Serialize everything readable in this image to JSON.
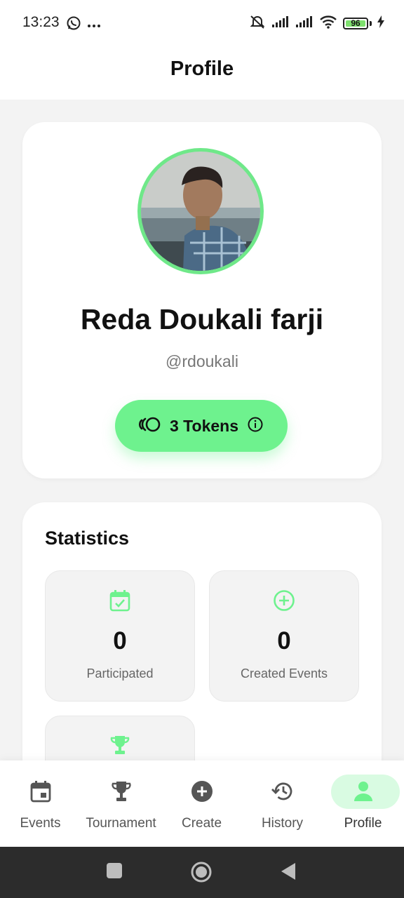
{
  "status_bar": {
    "time": "13:23",
    "battery": "96"
  },
  "header": {
    "title": "Profile"
  },
  "profile": {
    "name": "Reda Doukali farji",
    "handle": "@rdoukali",
    "tokens_label": "3 Tokens"
  },
  "statistics": {
    "title": "Statistics",
    "tiles": [
      {
        "value": "0",
        "label": "Participated",
        "icon": "calendar-check-icon"
      },
      {
        "value": "0",
        "label": "Created Events",
        "icon": "plus-circle-icon"
      },
      {
        "value": "",
        "label": "",
        "icon": "trophy-icon"
      }
    ]
  },
  "bottom_nav": {
    "items": [
      {
        "label": "Events",
        "icon": "calendar-icon",
        "active": false
      },
      {
        "label": "Tournament",
        "icon": "trophy-icon",
        "active": false
      },
      {
        "label": "Create",
        "icon": "plus-circle-icon",
        "active": false
      },
      {
        "label": "History",
        "icon": "history-icon",
        "active": false
      },
      {
        "label": "Profile",
        "icon": "person-icon",
        "active": true
      }
    ]
  },
  "colors": {
    "accent": "#6ef28e",
    "accent_light": "#d9fbe2",
    "icon_gray": "#555555"
  }
}
